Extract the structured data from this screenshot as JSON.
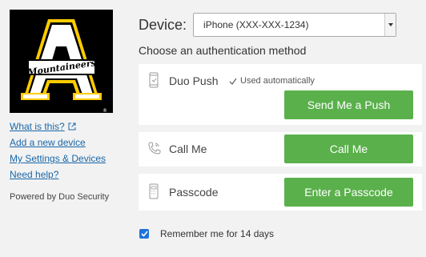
{
  "sidebar": {
    "logo_text": "Mountaineers",
    "links": [
      {
        "label": "What is this?"
      },
      {
        "label": "Add a new device"
      },
      {
        "label": "My Settings & Devices"
      },
      {
        "label": "Need help?"
      }
    ],
    "powered_by": "Powered by Duo Security"
  },
  "device": {
    "label": "Device:",
    "selected": "iPhone (XXX-XXX-1234)"
  },
  "methods": {
    "title": "Choose an authentication method",
    "push": {
      "label": "Duo Push",
      "note": "Used automatically",
      "button": "Send Me a Push"
    },
    "call": {
      "label": "Call Me",
      "button": "Call Me"
    },
    "passcode": {
      "label": "Passcode",
      "button": "Enter a Passcode"
    }
  },
  "remember": {
    "label": "Remember me for 14 days",
    "checked": true
  },
  "colors": {
    "button_green": "#5ab04b",
    "link_blue": "#1a67a8",
    "logo_gold": "#ffcc00",
    "checkbox_blue": "#1e73d8"
  }
}
